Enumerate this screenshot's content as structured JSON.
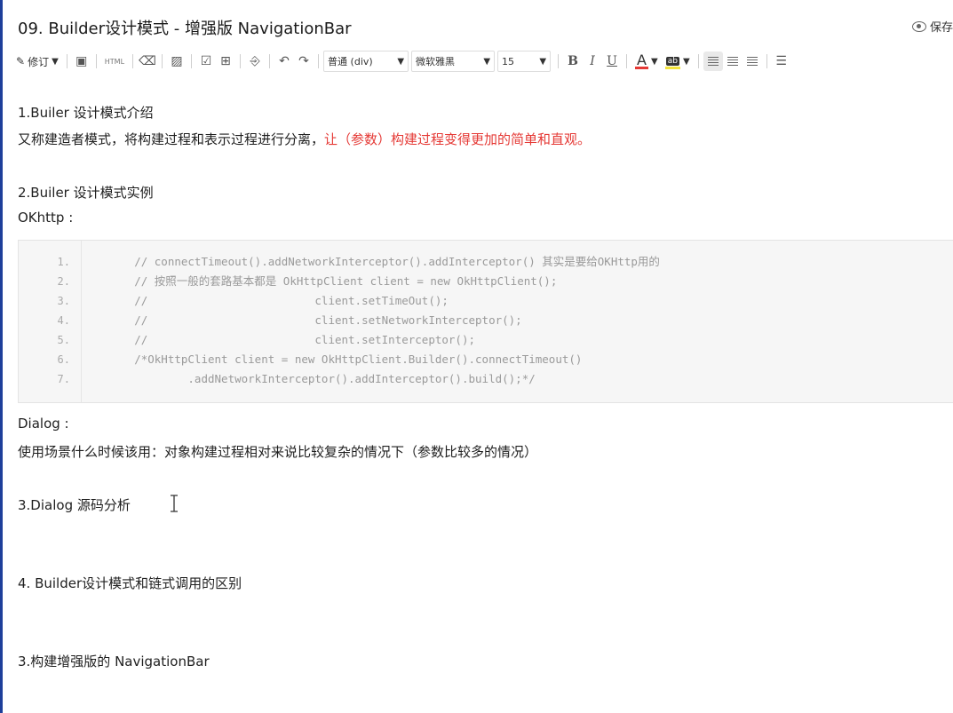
{
  "title": "09. Builder设计模式 - 增强版 NavigationBar",
  "save_label": "保存",
  "toolbar": {
    "revise_label": "修订",
    "html_label": "HTML",
    "paragraph_select": "普通 (div)",
    "font_select": "微软雅黑",
    "size_select": "15",
    "bold": "B",
    "italic": "I",
    "underline": "U",
    "font_color": "A",
    "highlight": "ab"
  },
  "content": {
    "h1": "1.Builer 设计模式介绍",
    "p1_plain": "又称建造者模式，将构建过程和表示过程进行分离，",
    "p1_red": "让（参数）构建过程变得更加的简单和直观。",
    "h2": "2.Builer 设计模式实例",
    "okhttp": "OKhttp :",
    "dialog": "Dialog :",
    "usage": "使用场景什么时候该用：对象构建过程相对来说比较复杂的情况下（参数比较多的情况）",
    "h3": "3.Dialog 源码分析",
    "h4": "4. Builder设计模式和链式调用的区别",
    "h5": "3.构建增强版的 NavigationBar"
  },
  "code": {
    "lines": [
      {
        "num": "1.",
        "text": "        // connectTimeout().addNetworkInterceptor().addInterceptor() 其实是要给OKHttp用的"
      },
      {
        "num": "2.",
        "text": "        // 按照一般的套路基本都是 OkHttpClient client = new OkHttpClient();"
      },
      {
        "num": "3.",
        "text": "        //                         client.setTimeOut();"
      },
      {
        "num": "4.",
        "text": "        //                         client.setNetworkInterceptor();"
      },
      {
        "num": "5.",
        "text": "        //                         client.setInterceptor();"
      },
      {
        "num": "6.",
        "text": "        /*OkHttpClient client = new OkHttpClient.Builder().connectTimeout()"
      },
      {
        "num": "7.",
        "text": "                .addNetworkInterceptor().addInterceptor().build();*/"
      }
    ]
  }
}
